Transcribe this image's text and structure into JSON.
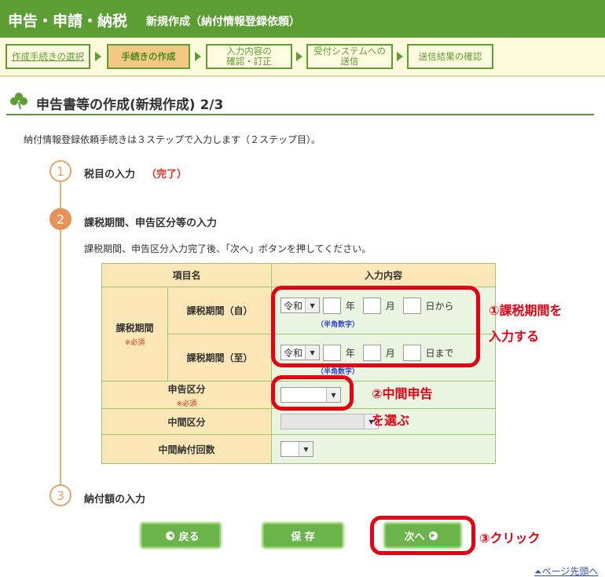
{
  "header": {
    "title": "申告・申請・納税",
    "subtitle": "新規作成（納付情報登録依頼）"
  },
  "steps": [
    {
      "label": "作成手続きの選択",
      "state": "done"
    },
    {
      "label": "手続きの作成",
      "state": "active"
    },
    {
      "label": "入力内容の\n確認・訂正",
      "state": "pending"
    },
    {
      "label": "受付システムへの\n送信",
      "state": "pending"
    },
    {
      "label": "送信結果の確認",
      "state": "pending"
    }
  ],
  "page_title": "申告書等の作成(新規作成) 2/3",
  "intro": "納付情報登録依頼手続きは３ステップで入力します（２ステップ目）。",
  "sections": [
    {
      "num": "1",
      "label": "税目の入力",
      "status": "（完了）"
    },
    {
      "num": "2",
      "label": "課税期間、申告区分等の入力",
      "desc": "課税期間、申告区分入力完了後、「次へ」ボタンを押してください。"
    },
    {
      "num": "3",
      "label": "納付額の入力"
    }
  ],
  "form": {
    "col_item": "項目名",
    "col_input": "入力内容",
    "tax_period": "課税期間",
    "required": "※必須",
    "period_from": "課税期間（自）",
    "period_to": "課税期間（至）",
    "era": "令和",
    "year": "年",
    "month": "月",
    "day_from": "日から",
    "day_to": "日まで",
    "half_width_hint": "（半角数字）",
    "declaration_type": "申告区分",
    "interim_type": "中間区分",
    "interim_payment_count": "中間納付回数"
  },
  "annotations": {
    "a1_line1": "①課税期間を",
    "a1_line2": "入力する",
    "a2_line1": "②中間申告",
    "a2_line2": "を選ぶ",
    "a3": "③クリック",
    "accent_color": "#e60012"
  },
  "buttons": {
    "back": "戻る",
    "save": "保 存",
    "next": "次へ"
  },
  "page_top": "ページ先頭へ",
  "colors": {
    "brand_green": "#5c9e33",
    "step_orange": "#e8925a",
    "table_header": "#fbe6b7",
    "table_cell": "#eaf5e1"
  }
}
